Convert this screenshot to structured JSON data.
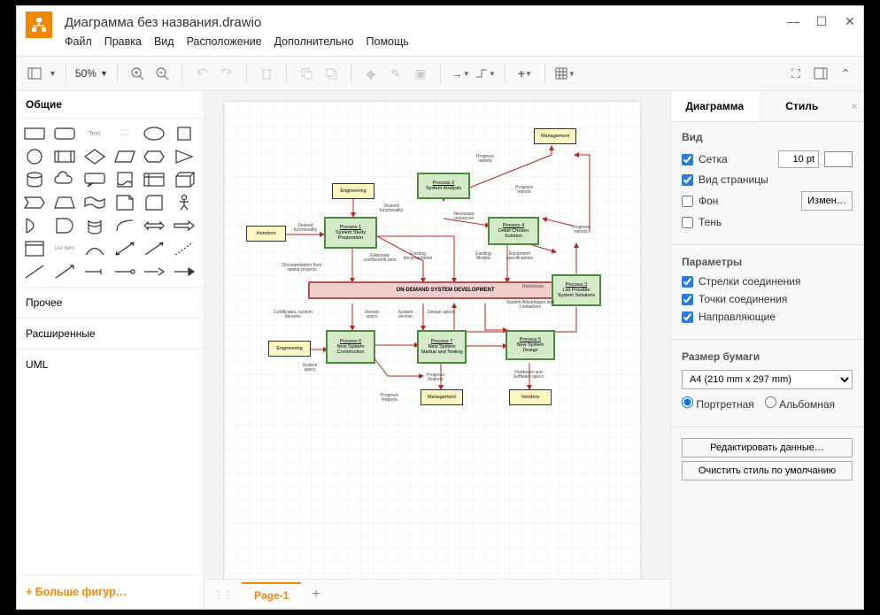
{
  "title": "Диаграмма без названия.drawio",
  "menu": [
    "Файл",
    "Правка",
    "Вид",
    "Расположение",
    "Дополнительно",
    "Помощь"
  ],
  "zoom": "50%",
  "left": {
    "header": "Общие",
    "cats": [
      "Прочее",
      "Расширенные",
      "UML"
    ],
    "more": "+  Больше фигур…"
  },
  "tabs": {
    "active": "Page-1"
  },
  "right": {
    "tab1": "Диаграмма",
    "tab2": "Стиль",
    "view": {
      "title": "Вид",
      "grid": "Сетка",
      "grid_val": "10 pt",
      "pageview": "Вид страницы",
      "bg": "Фон",
      "bg_btn": "Измен…",
      "shadow": "Тень"
    },
    "params": {
      "title": "Параметры",
      "conn_arrows": "Стрелки соединения",
      "conn_points": "Точки соединения",
      "guides": "Направляющие"
    },
    "paper": {
      "title": "Размер бумаги",
      "size": "A4 (210 mm x 297 mm)",
      "portrait": "Портретная",
      "landscape": "Альбомная"
    },
    "edit_data": "Редактировать данные…",
    "clear_style": "Очистить стиль по умолчанию"
  },
  "diagram": {
    "center": "ON-DEMAND SYSTEM DEVELOPMENT",
    "nodes": {
      "investors": "Investors",
      "engineering1": "Engineering",
      "engineering2": "Engineering",
      "management1": "Management",
      "management2": "Management",
      "vendors": "Vendors",
      "p1_t": "Process 1",
      "p1": "System Study Preperation",
      "p2_t": "Process 2",
      "p2": "System Analysis",
      "p3_t": "Process 3",
      "p3": "List Possible System Solutions",
      "p4_t": "Process 4",
      "p4": "Detail Chosen Solution",
      "p5_t": "Process 5",
      "p5": "New System Design",
      "p6_t": "Process 6",
      "p6": "New System Construction",
      "p7_t": "Process 7",
      "p7": "New System Startup and Testing"
    },
    "labels": {
      "desired_func": "Desired functionality",
      "doc_similar": "Documentation from similar projects",
      "elab_cost": "Elaborate cost/benefit ratio",
      "exist_doc": "Existing documentation",
      "nec_res": "Necessary resources",
      "prog_rep1": "Progress reports",
      "prog_rep2": "Progress reports",
      "prog_rep3": "Progress Reports",
      "prog_rep4": "Progress Reports",
      "prog_rep5": "Progress reports",
      "exist_models": "Existing Models",
      "equip_spec": "Equipment specifications",
      "sys_adv": "System Advantages and Limitations",
      "resources": "Resources",
      "cert_lib": "Certificates, system libraries",
      "ver_specs": "Version specs",
      "sys_ver": "System version",
      "des_specs": "Design specs",
      "sys_specs": "System specs",
      "hw_sw": "Hardware and Software specs"
    }
  }
}
